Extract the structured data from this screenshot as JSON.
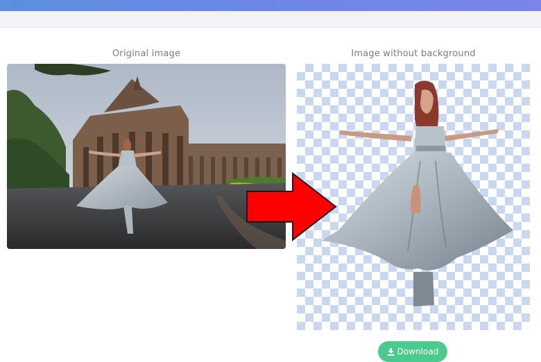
{
  "captions": {
    "original": "Original image",
    "result": "Image without background"
  },
  "download": {
    "label": "Download",
    "icon": "download-icon",
    "color": "#4cc98d"
  },
  "colors": {
    "header_gradient_start": "#5b8fe0",
    "header_gradient_end": "#7a84ea",
    "arrow": "#ff0000",
    "checker": "#c9d7ef"
  },
  "icons": {
    "arrow": "right-arrow-icon"
  }
}
